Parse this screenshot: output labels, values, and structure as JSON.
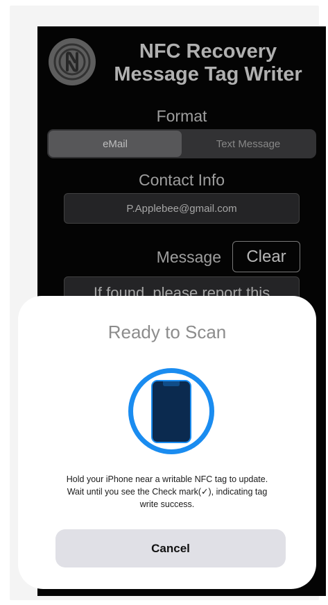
{
  "app": {
    "title_line1": "NFC Recovery",
    "title_line2": "Message Tag Writer",
    "format_label": "Format",
    "format_options": [
      "eMail",
      "Text Message"
    ],
    "format_selected": "eMail",
    "contact_label": "Contact Info",
    "contact_value": "P.Applebee@gmail.com",
    "message_label": "Message",
    "clear_label": "Clear",
    "message_value": "If found, please report this"
  },
  "scan_sheet": {
    "title": "Ready to Scan",
    "message_line1": "Hold your iPhone near a writable NFC tag to update.",
    "message_line2": "Wait until you see the Check mark(✓), indicating tag",
    "message_line3": "write success.",
    "cancel_label": "Cancel",
    "icon": "phone-scan-icon",
    "accent_color": "#1a8cf0"
  }
}
